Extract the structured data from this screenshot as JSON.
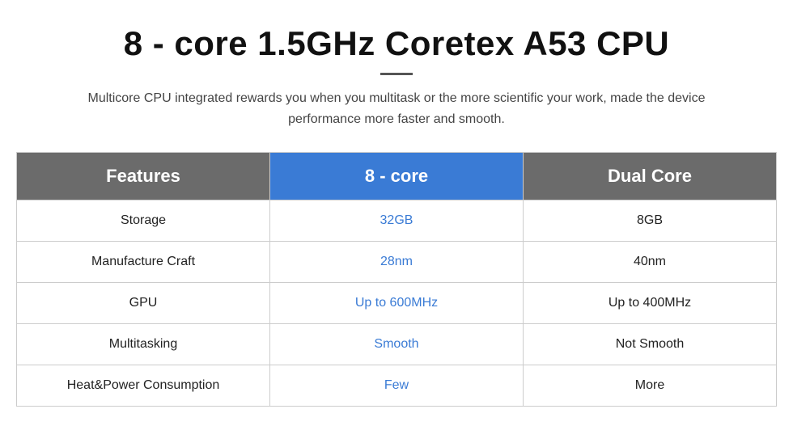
{
  "header": {
    "title": "8 - core 1.5GHz Coretex A53 CPU",
    "subtitle": "Multicore CPU integrated rewards you when you multitask or the more scientific your work, made the device performance more faster and smooth."
  },
  "table": {
    "columns": {
      "features": "Features",
      "core8": "8 - core",
      "dual": "Dual Core"
    },
    "rows": [
      {
        "feature": "Storage",
        "core8_value": "32GB",
        "dual_value": "8GB"
      },
      {
        "feature": "Manufacture Craft",
        "core8_value": "28nm",
        "dual_value": "40nm"
      },
      {
        "feature": "GPU",
        "core8_value": "Up to 600MHz",
        "dual_value": "Up to 400MHz"
      },
      {
        "feature": "Multitasking",
        "core8_value": "Smooth",
        "dual_value": "Not Smooth"
      },
      {
        "feature": "Heat&Power Consumption",
        "core8_value": "Few",
        "dual_value": "More"
      }
    ]
  }
}
